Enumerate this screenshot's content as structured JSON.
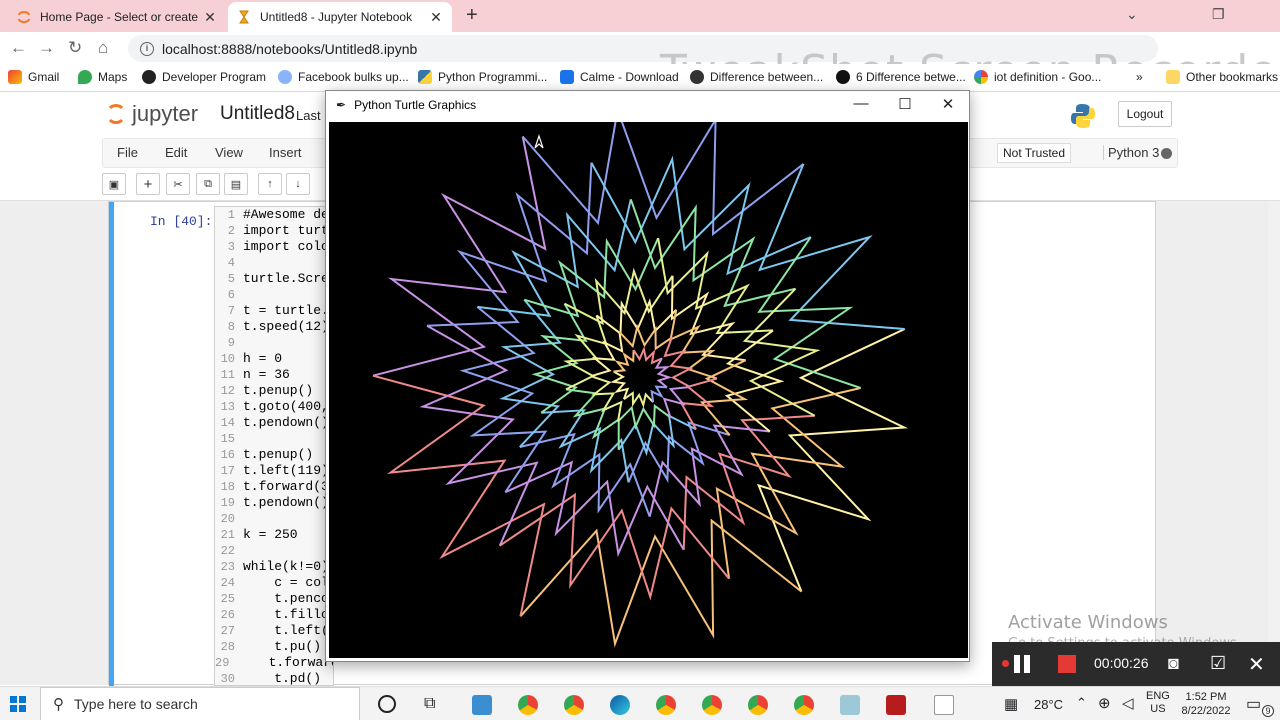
{
  "browser": {
    "tabs": [
      {
        "title": "Home Page - Select or create a n",
        "active": false
      },
      {
        "title": "Untitled8 - Jupyter Notebook",
        "active": true
      }
    ],
    "url": "localhost:8888/notebooks/Untitled8.ipynb",
    "watermark": "TweakShot Screen Recorder",
    "bookmarks": [
      "Gmail",
      "Maps",
      "Developer Program",
      "Facebook bulks up...",
      "Python Programmi...",
      "Calme - Download",
      "Difference between...",
      "6 Difference betwe...",
      "iot definition - Goo...",
      "Other bookmarks"
    ],
    "overflow": "»"
  },
  "jupyter": {
    "logo_text": "jupyter",
    "notebook_name": "Untitled8",
    "last_checkpoint": "Last",
    "logout_label": "Logout",
    "menus": [
      "File",
      "Edit",
      "View",
      "Insert"
    ],
    "trust_label": "Not Trusted",
    "kernel_label": "Python 3",
    "cell_prompt": "In [40]:",
    "code_lines": [
      {
        "n": "1",
        "t": "#Awesome de"
      },
      {
        "n": "2",
        "t": "import turt"
      },
      {
        "n": "3",
        "t": "import colo"
      },
      {
        "n": "4",
        "t": ""
      },
      {
        "n": "5",
        "t": "turtle.Scre"
      },
      {
        "n": "6",
        "t": ""
      },
      {
        "n": "7",
        "t": "t = turtle."
      },
      {
        "n": "8",
        "t": "t.speed(12)"
      },
      {
        "n": "9",
        "t": ""
      },
      {
        "n": "10",
        "t": "h = 0"
      },
      {
        "n": "11",
        "t": "n = 36"
      },
      {
        "n": "12",
        "t": "t.penup()"
      },
      {
        "n": "13",
        "t": "t.goto(400,"
      },
      {
        "n": "14",
        "t": "t.pendown()"
      },
      {
        "n": "15",
        "t": ""
      },
      {
        "n": "16",
        "t": "t.penup()"
      },
      {
        "n": "17",
        "t": "t.left(119)"
      },
      {
        "n": "18",
        "t": "t.forward(3"
      },
      {
        "n": "19",
        "t": "t.pendown()"
      },
      {
        "n": "20",
        "t": ""
      },
      {
        "n": "21",
        "t": "k = 250"
      },
      {
        "n": "22",
        "t": ""
      },
      {
        "n": "23",
        "t": "while(k!=0)"
      },
      {
        "n": "24",
        "t": "    c = col"
      },
      {
        "n": "25",
        "t": "    t.penco"
      },
      {
        "n": "26",
        "t": "    t.fillc"
      },
      {
        "n": "27",
        "t": "    t.left("
      },
      {
        "n": "28",
        "t": "    t.pu()"
      },
      {
        "n": "29",
        "t": "    t.forward(k)"
      },
      {
        "n": "30",
        "t": "    t.pd()"
      }
    ]
  },
  "turtle_window": {
    "title": "Python Turtle Graphics",
    "background": "#000000"
  },
  "windows": {
    "activate_title": "Activate Windows",
    "activate_sub": "Go to Settings to activate Windows."
  },
  "recorder": {
    "time": "00:00:26"
  },
  "taskbar": {
    "search_placeholder": "Type here to search",
    "temperature": "28°C",
    "lang_top": "ENG",
    "lang_bottom": "US",
    "time": "1:52 PM",
    "date": "8/22/2022",
    "notification_count": "9"
  },
  "colors": {
    "jupyter_orange": "#f37726",
    "cell_border": "#42a5f5",
    "tab_strip": "#f6d0d4"
  }
}
